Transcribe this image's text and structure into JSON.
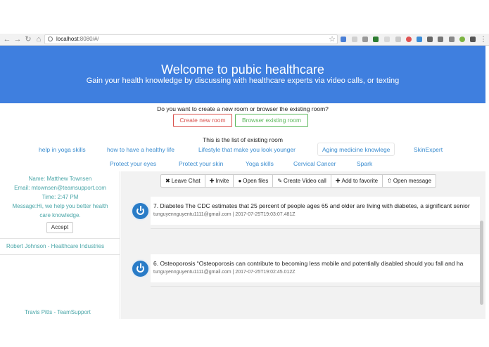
{
  "browser": {
    "url_host": "localhost",
    "url_port_path": ":8080/#/"
  },
  "hero": {
    "title": "Welcome to pubic healthcare",
    "subtitle": "Gain your health knowledge by discussing with healthcare experts via video calls, or texting"
  },
  "rooms_section": {
    "question": "Do you want to create a new room or browser the existing room?",
    "create_label": "Create new room",
    "browse_label": "Browser existing room",
    "list_title": "This is the list of existing room",
    "rooms_row1": [
      "help in yoga skills",
      "how to have a healthy life",
      "Lifestyle that make you look younger",
      "Aging medicine knowlege",
      "SkinExpert"
    ],
    "rooms_row2": [
      "Protect your eyes",
      "Protect your skin",
      "Yoga skills",
      "Cervical Cancer",
      "Spark"
    ]
  },
  "sidebar": {
    "request": {
      "name": "Name: Matthew Townsen",
      "email": "Email: mtownsen@teamsupport.com",
      "time": "Time: 2:47 PM",
      "message_line1": "Message:Hi, we help you better health",
      "message_line2": "care knowledge.",
      "accept_label": "Accept"
    },
    "contacts": [
      "Robert Johnson - Healthcare Industries",
      "Travis Pitts - TeamSupport"
    ]
  },
  "toolbar": {
    "leave_chat": "Leave Chat",
    "invite": "Invite",
    "open_files": "Open files",
    "create_video_call": "Create Video call",
    "add_to_favorite": "Add to favorite",
    "open_message": "Open message"
  },
  "messages": [
    {
      "text": "7. Diabetes The CDC estimates that 25 percent of people ages 65 and older are living with diabetes, a significant senior",
      "meta": "tunguyennguyentu1111@gmail.com | 2017-07-25T19:03:07.481Z"
    },
    {
      "text": "6. Osteoporosis “Osteoporosis can contribute to becoming less mobile and potentially disabled should you fall and ha",
      "meta": "tunguyennguyentu1111@gmail.com | 2017-07-25T19:02:45.012Z"
    }
  ],
  "colors": {
    "hero": "#3f7fdf",
    "create_button": "#d9534f",
    "browse_button": "#5cb85c",
    "room_link": "#3a8ccf",
    "sidebar_text": "#4aa6a8"
  }
}
